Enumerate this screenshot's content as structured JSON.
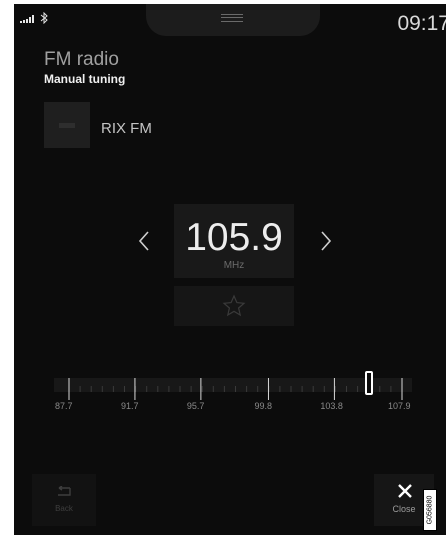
{
  "status_bar": {
    "clock": "09:17",
    "icons": [
      "signal-icon",
      "bluetooth-icon"
    ]
  },
  "header": {
    "title": "FM radio",
    "subtitle": "Manual tuning"
  },
  "station": {
    "name": "RIX FM"
  },
  "tuner": {
    "frequency": "105.9",
    "unit": "MHz",
    "current_mhz": 105.9,
    "range_mhz": [
      87.7,
      107.9
    ],
    "tick_labels": [
      "87.7",
      "91.7",
      "95.7",
      "99.8",
      "103.8",
      "107.9"
    ]
  },
  "footer": {
    "back_label": "Back",
    "close_label": "Close"
  },
  "figure_id": "G056880",
  "colors": {
    "background": "#0c0c0c",
    "text_primary": "#ededed",
    "text_secondary": "#a0a0a0",
    "handle": "#ffffff"
  }
}
